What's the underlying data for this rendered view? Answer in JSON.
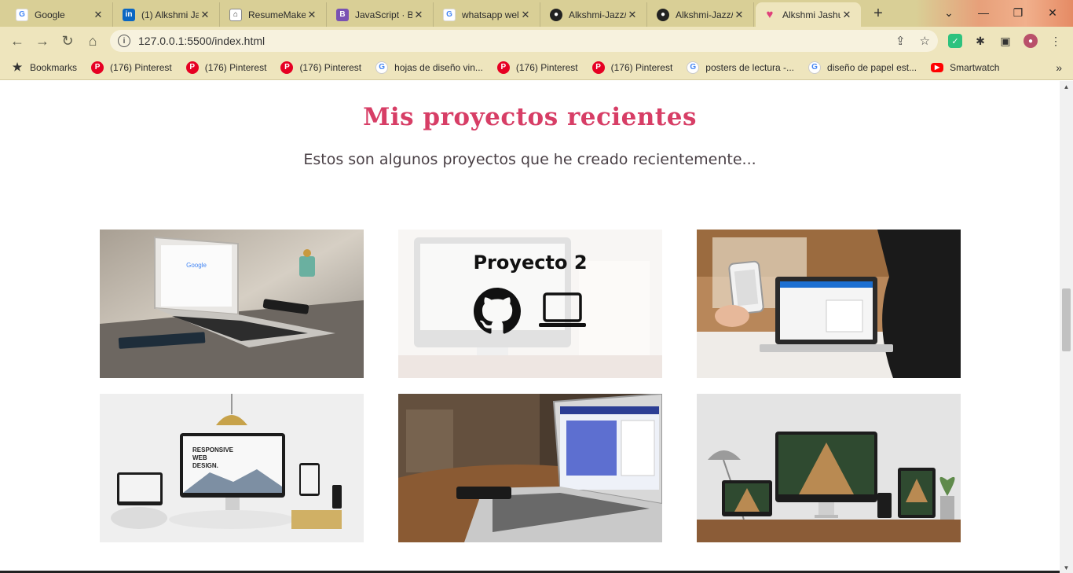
{
  "browser": {
    "tabs": [
      {
        "title": "Google",
        "icon": "google-icon"
      },
      {
        "title": "(1) Alkshmi Ja",
        "icon": "linkedin-icon"
      },
      {
        "title": "ResumeMake",
        "icon": "resume-icon"
      },
      {
        "title": "JavaScript · Bo",
        "icon": "bootstrap-icon"
      },
      {
        "title": "whatsapp wel",
        "icon": "google-icon"
      },
      {
        "title": "Alkshmi-Jazz/",
        "icon": "github-icon"
      },
      {
        "title": "Alkshmi-Jazz/",
        "icon": "github-icon"
      },
      {
        "title": "Alkshmi Jashu",
        "icon": "heart-icon"
      }
    ],
    "close_glyph": "✕",
    "new_tab_glyph": "+",
    "url": "127.0.0.1:5500/index.html",
    "bookmarks": [
      {
        "label": "Bookmarks",
        "icon": "star-icon"
      },
      {
        "label": "(176) Pinterest",
        "icon": "pinterest-icon"
      },
      {
        "label": "(176) Pinterest",
        "icon": "pinterest-icon"
      },
      {
        "label": "(176) Pinterest",
        "icon": "pinterest-icon"
      },
      {
        "label": "hojas de diseño vin...",
        "icon": "google-icon"
      },
      {
        "label": "(176) Pinterest",
        "icon": "pinterest-icon"
      },
      {
        "label": "(176) Pinterest",
        "icon": "pinterest-icon"
      },
      {
        "label": "posters de lectura -...",
        "icon": "google-icon"
      },
      {
        "label": "diseño de papel est...",
        "icon": "google-icon"
      },
      {
        "label": "Smartwatch",
        "icon": "youtube-icon"
      }
    ]
  },
  "page": {
    "title": "Mis proyectos recientes",
    "subtitle": "Estos son algunos proyectos que he creado recientemente...",
    "projects": [
      {
        "name": "laptop-desk",
        "hovered": false
      },
      {
        "name": "Proyecto 2",
        "hovered": true
      },
      {
        "name": "phone-laptop",
        "hovered": false
      },
      {
        "name": "responsive-devices",
        "hovered": false
      },
      {
        "name": "laptop-wood-table",
        "hovered": false
      },
      {
        "name": "architecture-devices",
        "hovered": false
      }
    ],
    "hover_overlay": {
      "title": "Proyecto 2",
      "icons": [
        "github-icon",
        "laptop-icon"
      ]
    }
  },
  "colors": {
    "accent": "#d73e66",
    "chrome": "#eee5bd",
    "tabstrip": "#d9cf96"
  }
}
